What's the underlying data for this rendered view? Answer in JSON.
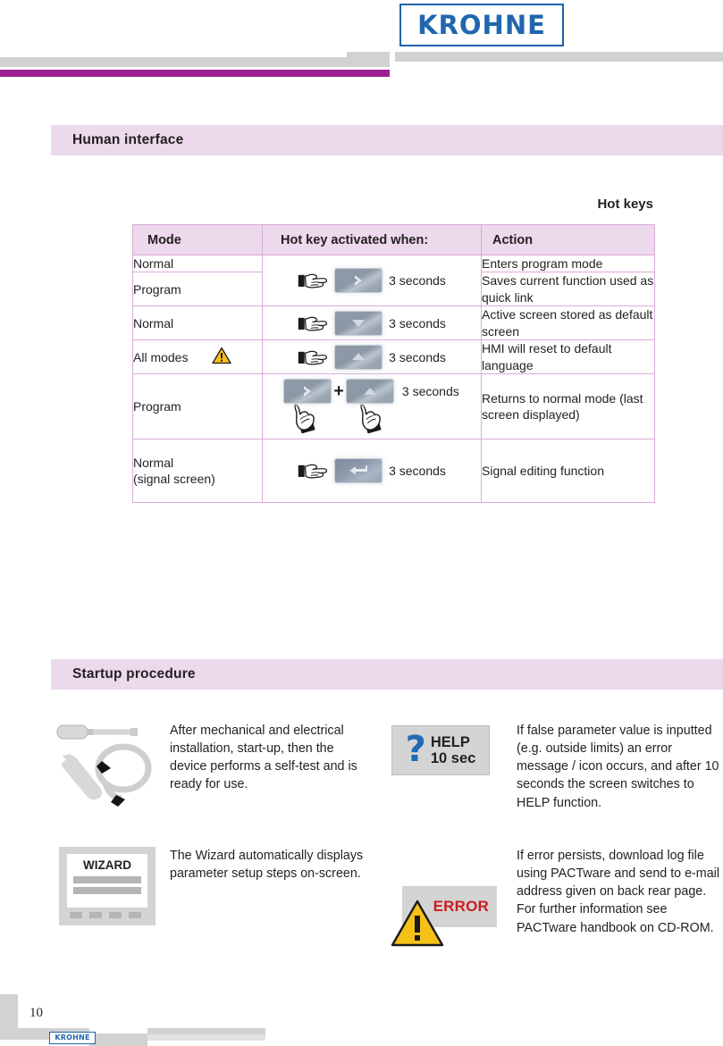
{
  "header": {
    "logo_text": "KROHNE",
    "accent_magenta": "#9c1f8f",
    "logo_blue": "#2166ae"
  },
  "sections": {
    "human_interface": "Human interface",
    "startup_procedure": "Startup procedure"
  },
  "hot_keys": {
    "title": "Hot keys",
    "columns": [
      "Mode",
      "Hot key activated when:",
      "Action"
    ],
    "rows": [
      {
        "mode": "Normal",
        "key_icons": [
          "hand-pointing-right",
          "right-arrow-key"
        ],
        "duration": "3 seconds",
        "action": "Enters program mode"
      },
      {
        "mode": "Program",
        "key_icons": [],
        "duration": "",
        "action": "Saves current function used as quick link"
      },
      {
        "mode": "Normal",
        "key_icons": [
          "hand-pointing-right",
          "down-arrow-key"
        ],
        "duration": "3 seconds",
        "action": "Active screen stored as default screen"
      },
      {
        "mode": "All modes",
        "mode_badge": "warning-triangle",
        "key_icons": [
          "hand-pointing-right",
          "up-arrow-key"
        ],
        "duration": "3 seconds",
        "action": "HMI will reset to default language"
      },
      {
        "mode": "Program",
        "key_icons": [
          "right-arrow-key",
          "plus",
          "up-arrow-key",
          "hand-pointing-up",
          "hand-pointing-up"
        ],
        "plus": "+",
        "duration": "3 seconds",
        "action": "Returns to normal mode (last screen displayed)"
      },
      {
        "mode": "Normal\n(signal screen)",
        "mode_line1": "Normal",
        "mode_line2": "(signal screen)",
        "key_icons": [
          "hand-pointing-right",
          "enter-key"
        ],
        "duration": "3 seconds",
        "action": "Signal editing function"
      }
    ],
    "header_bg": "#ecd9ec",
    "border": "#dcaada"
  },
  "startup": {
    "items": [
      {
        "icon": "screwdriver-wrench-icon",
        "text": "After mechanical and electrical installation, start-up, then the device performs a self-test and is ready for use."
      },
      {
        "icon": "help-screen-icon",
        "icon_labels": {
          "question": "?",
          "line1": "HELP",
          "line2": "10 sec"
        },
        "text": "If false parameter value is inputted (e.g. outside limits) an error message / icon occurs, and after 10 seconds the screen switches to HELP function."
      },
      {
        "icon": "wizard-screen-icon",
        "icon_labels": {
          "title": "WIZARD"
        },
        "text": "The Wizard automatically displays parameter setup steps on-screen."
      },
      {
        "icon": "error-screen-icon",
        "icon_labels": {
          "word": "ERROR"
        },
        "text": "If error persists, download log file using PACTware and send to e-mail address given on back rear page. For further information see PACTware handbook on CD-ROM."
      }
    ],
    "error_red": "#cc1b22",
    "warning_yellow": "#f5c119"
  },
  "footer": {
    "page_number": "10",
    "logo_text": "KROHNE"
  }
}
